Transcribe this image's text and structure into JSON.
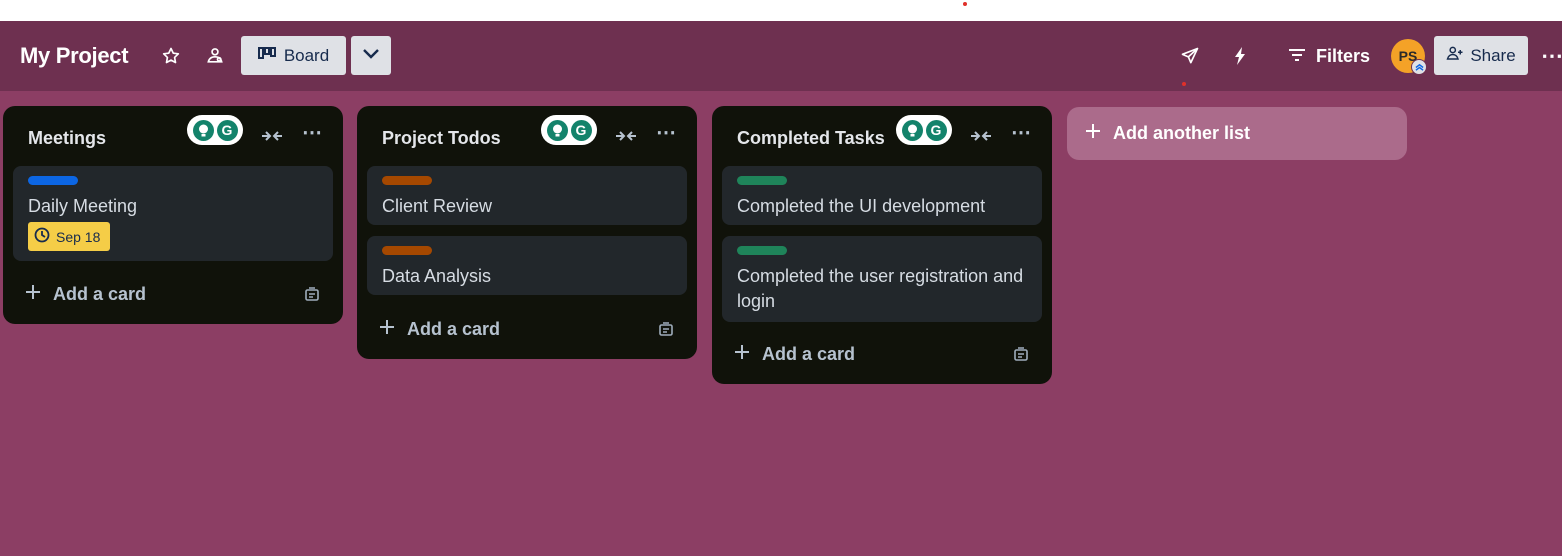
{
  "header": {
    "board_title": "My Project",
    "view_label": "Board",
    "filters_label": "Filters",
    "avatar_initials": "PS",
    "share_label": "Share",
    "more_label": "⋯"
  },
  "lists": [
    {
      "title": "Meetings",
      "cards": [
        {
          "label_color": "#0c66e4",
          "text": "Daily Meeting",
          "due": "Sep 18"
        }
      ],
      "add_card_label": "Add a card"
    },
    {
      "title": "Project Todos",
      "cards": [
        {
          "label_color": "#a54800",
          "text": "Client Review"
        },
        {
          "label_color": "#a54800",
          "text": "Data Analysis"
        }
      ],
      "add_card_label": "Add a card"
    },
    {
      "title": "Completed Tasks",
      "cards": [
        {
          "label_color": "#1f845a",
          "text": "Completed the UI development"
        },
        {
          "label_color": "#1f845a",
          "text": "Completed the user registration and login"
        }
      ],
      "add_card_label": "Add a card"
    }
  ],
  "add_list_label": "Add another list",
  "colors": {
    "board_background": "#8c3e64",
    "header_background": "#6e3050",
    "list_background": "#10120a",
    "card_background": "#22272b",
    "due_badge": "#f5cd47"
  },
  "icons": [
    "star-icon",
    "workspace-visibility-icon",
    "board-view-icon",
    "chevron-down-icon",
    "send-icon",
    "bolt-icon",
    "filter-icon",
    "add-member-icon",
    "more-icon",
    "grammarly-icon",
    "collapse-list-icon",
    "plus-icon",
    "card-template-icon",
    "clock-icon"
  ]
}
